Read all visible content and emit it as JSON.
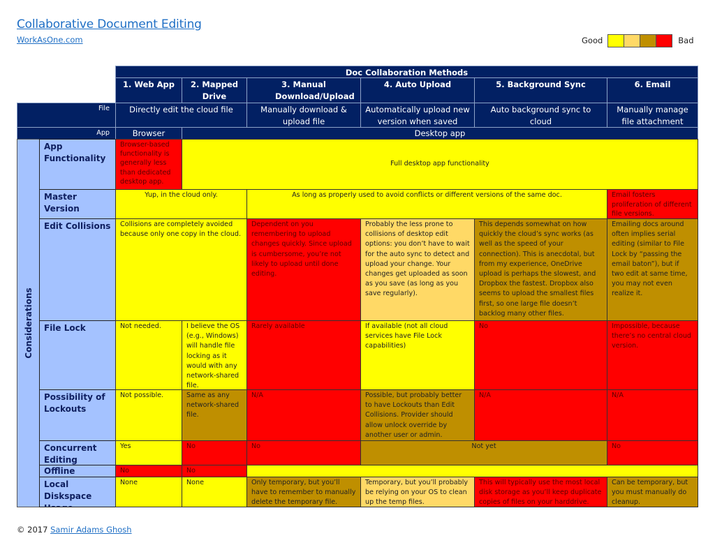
{
  "header": {
    "title": "Collaborative Document Editing",
    "site_link": "WorkAsOne.com"
  },
  "legend": {
    "good_label": "Good",
    "bad_label": "Bad",
    "scale_colors": [
      "#ffff00",
      "#ffd966",
      "#bf8f00",
      "#ff0000"
    ]
  },
  "table": {
    "group_title": "Doc Collaboration Methods",
    "methods": [
      "1. Web App",
      "2. Mapped Drive",
      "3. Manual Download/Upload",
      "4. Auto Upload",
      "5. Background Sync",
      "6. Email"
    ],
    "file_row": {
      "label": "File",
      "cells": [
        "Directly edit the cloud file",
        "Manually download & upload file",
        "Automatically upload new version when saved",
        "Auto background sync to cloud",
        "Manually manage file attachment"
      ]
    },
    "app_row": {
      "label": "App",
      "cells": [
        "Browser",
        "Desktop app"
      ]
    },
    "category_label": "Considerations",
    "rows": [
      {
        "label": "App Functionality",
        "cells": [
          {
            "text": "Browser-based functionality is generally less than dedicated desktop app.",
            "rating": "bad"
          },
          {
            "text": "Full desktop app functionality",
            "rating": "good"
          }
        ]
      },
      {
        "label": "Master Version",
        "cells": [
          {
            "text": "Yup, in the cloud only.",
            "rating": "good"
          },
          {
            "text": "As long as properly used to avoid conflicts or different versions of the same doc.",
            "rating": "good"
          },
          {
            "text": "Email fosters proliferation of different file versions.",
            "rating": "bad"
          }
        ]
      },
      {
        "label": "Edit Collisions",
        "cells": [
          {
            "text": "Collisions are completely avoided because only one copy in the cloud.",
            "rating": "good"
          },
          {
            "text": "Dependent on you remembering to upload changes quickly.  Since upload is cumbersome, you’re not likely to upload until done editing.",
            "rating": "bad"
          },
          {
            "text": "Probably the less prone to collisions of desktop edit options: you don’t have to wait for the auto sync to detect and upload your change.  Your changes get uploaded as soon as you save (as long as you save regularly).",
            "rating": "fair"
          },
          {
            "text": "This depends somewhat on how quickly the cloud’s sync works (as well as the speed of your connection).  This is anecdotal, but from my experience, OneDrive upload is perhaps the slowest, and Dropbox the fastest.  Dropbox also seems to upload the smallest files first, so one large file doesn’t backlog many other files.",
            "rating": "poor"
          },
          {
            "text": "Emailing docs around often implies serial editing (similar to File Lock by “passing the email baton”), but if two edit at same time, you may not even realize it.",
            "rating": "poor"
          }
        ]
      },
      {
        "label": "File Lock",
        "cells": [
          {
            "text": "Not needed.",
            "rating": "good"
          },
          {
            "text": "I believe the OS (e.g., Windows) will handle file locking as it would with any network-shared file.",
            "rating": "good"
          },
          {
            "text": "Rarely available",
            "rating": "bad"
          },
          {
            "text": "If available (not all cloud services have File Lock capabilities)",
            "rating": "good"
          },
          {
            "text": "No",
            "rating": "bad"
          },
          {
            "text": "Impossible, because there’s no central cloud version.",
            "rating": "bad"
          }
        ]
      },
      {
        "label": "Possibility of Lockouts",
        "cells": [
          {
            "text": "Not possible.",
            "rating": "good"
          },
          {
            "text": "Same as any network-shared file.",
            "rating": "poor"
          },
          {
            "text": "N/A",
            "rating": "bad"
          },
          {
            "text": "Possible, but probably better to have Lockouts than Edit Collisions.  Provider should allow unlock override by another user or admin.",
            "rating": "poor"
          },
          {
            "text": "N/A",
            "rating": "bad"
          },
          {
            "text": "N/A",
            "rating": "bad"
          }
        ]
      },
      {
        "label": "Concurrent Editing",
        "cells": [
          {
            "text": "Yes",
            "rating": "good"
          },
          {
            "text": "No",
            "rating": "bad"
          },
          {
            "text": "No",
            "rating": "bad"
          },
          {
            "text": "Not yet",
            "rating": "poor"
          },
          {
            "text": "No",
            "rating": "bad"
          }
        ]
      },
      {
        "label": "Offline Editing",
        "cells": [
          {
            "text": "No",
            "rating": "bad"
          },
          {
            "text": "No",
            "rating": "bad"
          },
          {
            "text": "",
            "rating": "good"
          }
        ]
      },
      {
        "label": "Local Diskspace Usage",
        "cells": [
          {
            "text": "None",
            "rating": "good"
          },
          {
            "text": "None",
            "rating": "good"
          },
          {
            "text": "Only temporary, but you’ll have to remember to manually delete the temporary file.",
            "rating": "poor"
          },
          {
            "text": "Temporary, but you’ll probably be relying on your OS to clean up the temp files.",
            "rating": "fair"
          },
          {
            "text": "This will typically use the most local disk storage as you’ll keep duplicate copies of files on your harddrive.",
            "rating": "bad"
          },
          {
            "text": "Can be temporary, but you must manually do cleanup.",
            "rating": "poor"
          }
        ]
      }
    ]
  },
  "footer": {
    "copyright": "© 2017 ",
    "author_link": "Samir Adams Ghosh"
  }
}
